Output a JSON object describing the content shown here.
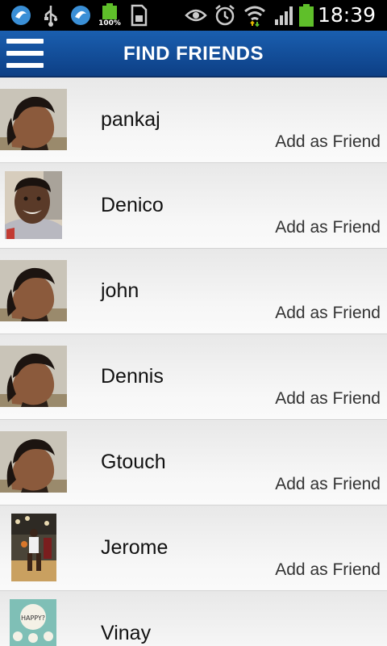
{
  "status_bar": {
    "time": "18:39",
    "battery_level_label": "100%",
    "icons": [
      "app-icon",
      "usb-icon",
      "app-icon",
      "battery-full-icon",
      "sd-card-icon",
      "eye-icon",
      "alarm-icon",
      "wifi-icon",
      "signal-icon",
      "battery-icon"
    ]
  },
  "header": {
    "title": "FIND FRIENDS",
    "menu_icon": "hamburger-menu-icon",
    "background_color": "#0f4a96"
  },
  "friends": [
    {
      "name": "pankaj",
      "action": "Add as Friend"
    },
    {
      "name": "Denico",
      "action": "Add as Friend"
    },
    {
      "name": "john",
      "action": "Add as Friend"
    },
    {
      "name": "Dennis",
      "action": "Add as Friend"
    },
    {
      "name": "Gtouch",
      "action": "Add as Friend"
    },
    {
      "name": "Jerome",
      "action": "Add as Friend"
    },
    {
      "name": "Vinay",
      "action": ""
    }
  ]
}
